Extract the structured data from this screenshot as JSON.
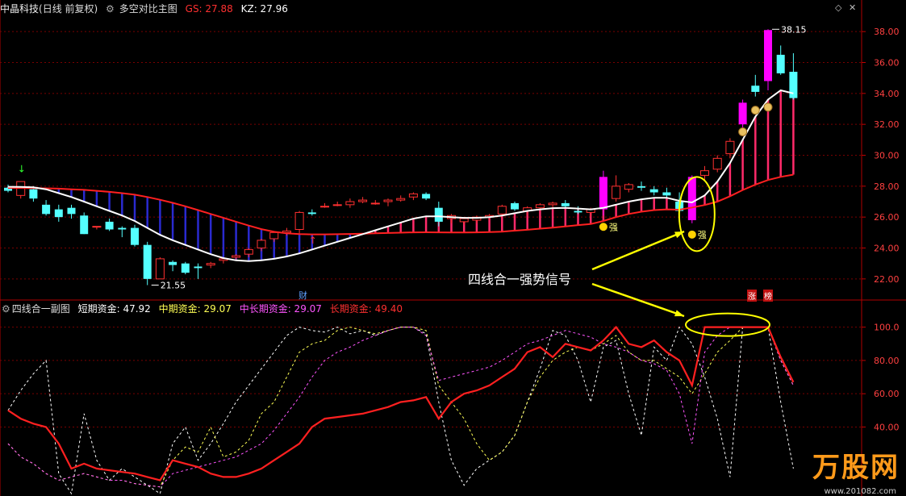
{
  "main_header": {
    "stock": "中晶科技",
    "period": "(日线 前复权)",
    "indicator": "多空对比主图",
    "gs_label": "GS: 27.88",
    "kz_label": "KZ: 27.96"
  },
  "sub_header": {
    "indicator": "四线合一副图",
    "short_label": "短期资金: 47.92",
    "mid_label": "中期资金: 29.07",
    "midlong_label": "中长期资金: 29.07",
    "long_label": "长期资金: 49.40"
  },
  "annotation": {
    "text": "四线合一强势信号"
  },
  "markers": {
    "strong": "强",
    "cai": "财",
    "zhang": "涨",
    "bang": "榜"
  },
  "watermark": {
    "brand": "万股网",
    "url": "www.201082.com"
  },
  "colors": {
    "up": "#ff3030",
    "down": "#54ffff",
    "ma": "#ffffff",
    "gs": "#ff2020",
    "bull_bar": "#ff2a6a",
    "bear_bar": "#2a2ad0",
    "signal": "#ff00ff",
    "highlight": "#ffff00",
    "grid": "#7a0000"
  },
  "chart_data": [
    {
      "type": "candlestick",
      "ylim": [
        21,
        39
      ],
      "yticks": [
        "22.00",
        "24.00",
        "26.00",
        "28.00",
        "30.00",
        "32.00",
        "34.00",
        "36.00",
        "38.00"
      ],
      "high_label": "38.15",
      "low_label": "21.55",
      "candles": [
        [
          27.9,
          28.1,
          27.6,
          27.7
        ],
        [
          27.4,
          28.2,
          27.2,
          28.3
        ],
        [
          27.8,
          28.0,
          27.0,
          27.2
        ],
        [
          26.8,
          27.1,
          26.1,
          26.2
        ],
        [
          26.5,
          26.8,
          25.7,
          26.0
        ],
        [
          26.6,
          26.8,
          25.9,
          26.2
        ],
        [
          26.1,
          26.3,
          24.9,
          24.9
        ],
        [
          25.4,
          25.4,
          25.2,
          25.4
        ],
        [
          25.7,
          25.9,
          25.1,
          25.2
        ],
        [
          25.3,
          25.4,
          24.7,
          25.2
        ],
        [
          25.3,
          25.5,
          24.1,
          24.2
        ],
        [
          24.2,
          24.4,
          21.6,
          22.0
        ],
        [
          22.0,
          23.4,
          22.1,
          23.3
        ],
        [
          23.1,
          23.2,
          22.5,
          22.9
        ],
        [
          23.0,
          23.1,
          22.3,
          22.4
        ],
        [
          22.8,
          23.0,
          22.0,
          22.7
        ],
        [
          22.9,
          23.1,
          22.7,
          23.0
        ],
        [
          23.2,
          23.4,
          23.0,
          23.3
        ],
        [
          23.4,
          23.6,
          23.2,
          23.5
        ],
        [
          23.6,
          24.0,
          23.4,
          23.9
        ],
        [
          24.0,
          24.6,
          23.8,
          24.5
        ],
        [
          24.6,
          25.1,
          24.4,
          25.0
        ],
        [
          25.0,
          25.3,
          24.8,
          25.1
        ],
        [
          25.2,
          26.4,
          24.9,
          26.3
        ],
        [
          26.3,
          26.5,
          26.1,
          26.2
        ],
        [
          26.7,
          26.9,
          26.6,
          26.7
        ],
        [
          26.8,
          27.0,
          26.7,
          26.8
        ],
        [
          26.8,
          27.2,
          26.6,
          27.0
        ],
        [
          27.0,
          27.3,
          26.9,
          27.1
        ],
        [
          26.9,
          27.1,
          26.8,
          26.9
        ],
        [
          27.0,
          27.2,
          26.7,
          27.1
        ],
        [
          27.1,
          27.4,
          27.0,
          27.2
        ],
        [
          27.3,
          27.6,
          27.1,
          27.5
        ],
        [
          27.5,
          27.6,
          27.1,
          27.2
        ],
        [
          26.6,
          27.0,
          25.4,
          25.7
        ],
        [
          25.9,
          26.2,
          25.6,
          26.1
        ],
        [
          25.7,
          26.0,
          25.5,
          25.9
        ],
        [
          25.8,
          26.1,
          25.6,
          26.0
        ],
        [
          26.0,
          26.2,
          25.8,
          26.1
        ],
        [
          26.2,
          26.8,
          26.0,
          26.7
        ],
        [
          26.9,
          27.0,
          26.4,
          26.5
        ],
        [
          26.4,
          26.7,
          26.1,
          26.6
        ],
        [
          26.6,
          26.9,
          26.4,
          26.8
        ],
        [
          26.8,
          27.0,
          26.5,
          26.9
        ],
        [
          26.9,
          27.1,
          26.6,
          26.7
        ],
        [
          26.4,
          26.7,
          26.2,
          26.3
        ],
        [
          26.3,
          26.6,
          26.0,
          26.5
        ],
        [
          26.5,
          29.0,
          26.1,
          28.6
        ],
        [
          27.2,
          28.7,
          27.0,
          28.0
        ],
        [
          27.8,
          28.2,
          27.6,
          28.1
        ],
        [
          28.0,
          28.3,
          27.7,
          27.9
        ],
        [
          27.8,
          28.0,
          27.4,
          27.6
        ],
        [
          27.6,
          27.9,
          27.2,
          27.4
        ],
        [
          27.0,
          27.6,
          26.0,
          26.4
        ],
        [
          25.8,
          28.7,
          25.6,
          28.6
        ],
        [
          28.7,
          29.3,
          28.4,
          29.0
        ],
        [
          29.1,
          30.0,
          28.9,
          29.8
        ],
        [
          30.1,
          31.1,
          29.8,
          30.9
        ],
        [
          32.0,
          33.6,
          31.8,
          33.4
        ],
        [
          34.5,
          35.2,
          33.8,
          34.1
        ],
        [
          34.8,
          38.15,
          34.2,
          38.1
        ],
        [
          36.5,
          37.1,
          35.2,
          35.3
        ],
        [
          35.4,
          36.6,
          33.6,
          33.7
        ]
      ],
      "gs": [
        27.88,
        27.88,
        27.87,
        27.86,
        27.84,
        27.8,
        27.76,
        27.7,
        27.63,
        27.55,
        27.45,
        27.3,
        27.12,
        26.92,
        26.7,
        26.45,
        26.2,
        25.95,
        25.7,
        25.45,
        25.22,
        25.05,
        24.95,
        24.9,
        24.88,
        24.88,
        24.89,
        24.91,
        24.93,
        24.95,
        24.97,
        24.99,
        25.01,
        25.02,
        25.01,
        25.0,
        25.0,
        25.01,
        25.03,
        25.06,
        25.12,
        25.18,
        25.25,
        25.32,
        25.4,
        25.48,
        25.55,
        25.75,
        26.0,
        26.2,
        26.35,
        26.45,
        26.5,
        26.48,
        26.62,
        26.78,
        27.0,
        27.35,
        27.75,
        28.1,
        28.4,
        28.6,
        28.75
      ],
      "ma": [
        27.96,
        27.95,
        27.93,
        27.8,
        27.55,
        27.3,
        27.0,
        26.7,
        26.4,
        26.1,
        25.75,
        25.3,
        24.85,
        24.5,
        24.2,
        23.9,
        23.6,
        23.35,
        23.2,
        23.15,
        23.2,
        23.3,
        23.45,
        23.65,
        23.9,
        24.15,
        24.4,
        24.65,
        24.9,
        25.15,
        25.4,
        25.65,
        25.9,
        26.05,
        26.05,
        26.0,
        25.95,
        25.95,
        26.0,
        26.1,
        26.25,
        26.4,
        26.5,
        26.58,
        26.6,
        26.55,
        26.5,
        26.6,
        26.8,
        27.0,
        27.15,
        27.25,
        27.25,
        27.05,
        26.95,
        27.4,
        28.3,
        29.5,
        31.0,
        32.5,
        33.6,
        34.2,
        34.0
      ],
      "signal_days": [
        54,
        60
      ],
      "strong_days": [
        47,
        54
      ]
    },
    {
      "type": "line",
      "ylim": [
        0,
        110
      ],
      "yticks": [
        "40.00",
        "60.00",
        "80.00",
        "100.0"
      ],
      "series": [
        {
          "name": "短期资金",
          "color": "#ffffff",
          "values": [
            50,
            62,
            72,
            80,
            12,
            0,
            48,
            20,
            8,
            15,
            10,
            5,
            0,
            30,
            40,
            20,
            30,
            42,
            55,
            65,
            75,
            85,
            95,
            100,
            98,
            97,
            100,
            96,
            98,
            95,
            98,
            100,
            100,
            96,
            55,
            20,
            5,
            15,
            20,
            25,
            35,
            55,
            75,
            98,
            95,
            80,
            55,
            88,
            92,
            60,
            35,
            88,
            80,
            100,
            90,
            70,
            45,
            10,
            100,
            100,
            100,
            55,
            15
          ]
        },
        {
          "name": "中期资金",
          "color": "#ffff55",
          "values": [
            30,
            22,
            18,
            12,
            8,
            10,
            12,
            10,
            8,
            8,
            6,
            5,
            4,
            20,
            28,
            25,
            40,
            22,
            25,
            32,
            48,
            55,
            70,
            85,
            90,
            92,
            98,
            100,
            98,
            96,
            98,
            100,
            100,
            98,
            65,
            55,
            45,
            30,
            20,
            25,
            35,
            55,
            70,
            80,
            85,
            88,
            86,
            90,
            95,
            85,
            80,
            80,
            75,
            70,
            60,
            72,
            85,
            92,
            100,
            100,
            100,
            80,
            65
          ]
        },
        {
          "name": "中长期资金",
          "color": "#ff55ff",
          "values": [
            30,
            22,
            18,
            12,
            8,
            10,
            12,
            10,
            8,
            8,
            6,
            5,
            4,
            12,
            14,
            16,
            18,
            20,
            22,
            26,
            30,
            38,
            48,
            58,
            70,
            80,
            85,
            88,
            92,
            95,
            98,
            100,
            100,
            95,
            68,
            70,
            72,
            74,
            76,
            80,
            85,
            90,
            92,
            95,
            98,
            96,
            94,
            90,
            88,
            85,
            80,
            78,
            74,
            60,
            30,
            85,
            95,
            100,
            100,
            100,
            100,
            80,
            65
          ]
        },
        {
          "name": "长期资金",
          "color": "#ff2020",
          "values": [
            50,
            45,
            42,
            40,
            30,
            15,
            18,
            15,
            14,
            13,
            12,
            10,
            8,
            20,
            18,
            16,
            12,
            10,
            10,
            12,
            15,
            20,
            25,
            30,
            40,
            45,
            46,
            47,
            48,
            50,
            52,
            55,
            56,
            58,
            45,
            55,
            60,
            62,
            65,
            70,
            75,
            85,
            88,
            82,
            90,
            88,
            86,
            92,
            100,
            90,
            88,
            92,
            85,
            80,
            65,
            100,
            100,
            100,
            100,
            100,
            100,
            82,
            67
          ]
        }
      ]
    }
  ]
}
